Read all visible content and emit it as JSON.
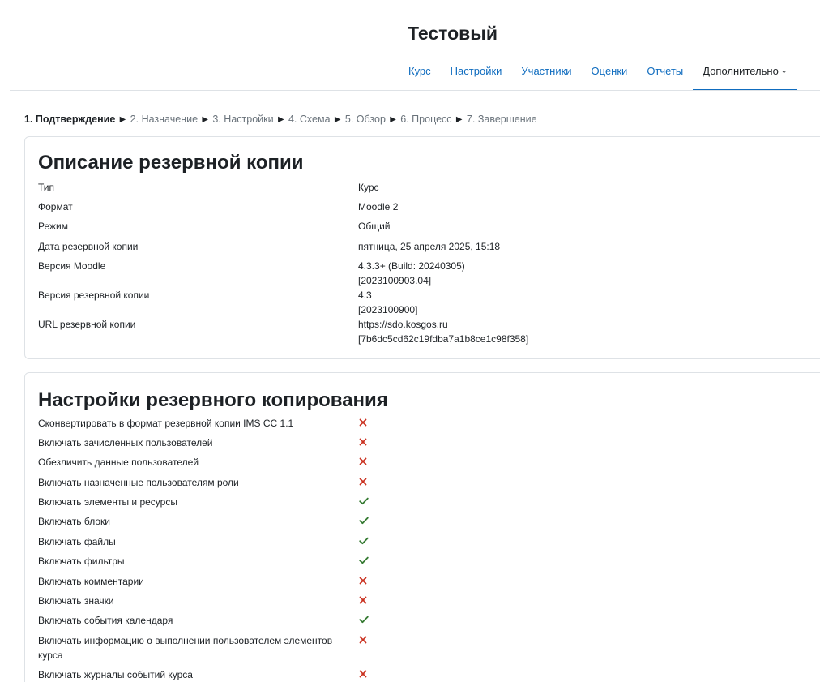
{
  "course": {
    "title": "Тестовый"
  },
  "nav": {
    "items": [
      "Курс",
      "Настройки",
      "Участники",
      "Оценки",
      "Отчеты"
    ],
    "more_label": "Дополнительно"
  },
  "steps": {
    "current": "1. Подтверждение",
    "others": [
      "2. Назначение",
      "3. Настройки",
      "4. Схема",
      "5. Обзор",
      "6. Процесс",
      "7. Завершение"
    ],
    "separator": "►"
  },
  "backup_details": {
    "heading": "Описание резервной копии",
    "rows": [
      {
        "label": "Тип",
        "value": [
          "Курс"
        ]
      },
      {
        "label": "Формат",
        "value": [
          "Moodle 2"
        ]
      },
      {
        "label": "Режим",
        "value": [
          "Общий"
        ]
      },
      {
        "label": "Дата резервной копии",
        "value": [
          "пятница, 25 апреля 2025, 15:18"
        ]
      },
      {
        "label": "Версия Moodle",
        "value": [
          "4.3.3+ (Build: 20240305)",
          "[2023100903.04]"
        ]
      },
      {
        "label": "Версия резервной копии",
        "value": [
          "4.3",
          "[2023100900]"
        ]
      },
      {
        "label": "URL резервной копии",
        "value": [
          "https://sdo.kosgos.ru",
          "[7b6dc5cd62c19fdba7a1b8ce1c98f358]"
        ]
      }
    ]
  },
  "backup_settings": {
    "heading": "Настройки резервного копирования",
    "colors": {
      "yes": "#357a32",
      "no": "#ca3120"
    },
    "rows": [
      {
        "label": "Сконвертировать в формат резервной копии IMS CC 1.1",
        "enabled": false
      },
      {
        "label": "Включать зачисленных пользователей",
        "enabled": false
      },
      {
        "label": "Обезличить данные пользователей",
        "enabled": false
      },
      {
        "label": "Включать назначенные пользователям роли",
        "enabled": false
      },
      {
        "label": "Включать элементы и ресурсы",
        "enabled": true
      },
      {
        "label": "Включать блоки",
        "enabled": true
      },
      {
        "label": "Включать файлы",
        "enabled": true
      },
      {
        "label": "Включать фильтры",
        "enabled": true
      },
      {
        "label": "Включать комментарии",
        "enabled": false
      },
      {
        "label": "Включать значки",
        "enabled": false
      },
      {
        "label": "Включать события календаря",
        "enabled": true
      },
      {
        "label": "Включать информацию о выполнении пользователем элементов курса",
        "enabled": false
      },
      {
        "label": "Включать журналы событий курса",
        "enabled": false
      }
    ]
  }
}
